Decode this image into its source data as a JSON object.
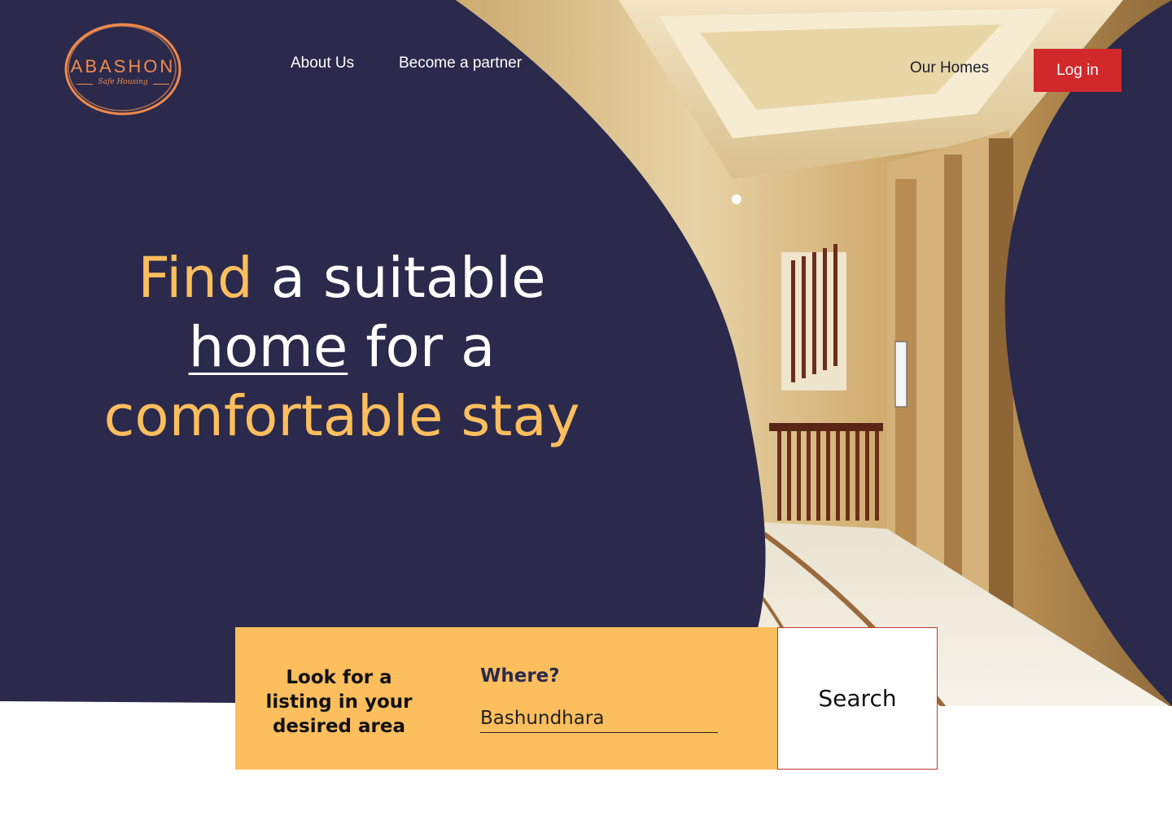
{
  "brand": {
    "name": "ABASHON",
    "tagline": "Safe Housing"
  },
  "nav": {
    "about": "About Us",
    "partner": "Become a partner",
    "homes": "Our Homes",
    "login": "Log in"
  },
  "hero": {
    "line1_accent": "Find",
    "line1_rest": " a suitable",
    "line2_underlined": "home",
    "line2_rest": " for a",
    "line3_accent": "comfortable stay"
  },
  "search": {
    "prompt": "Look for a listing in your desired area",
    "where_label": "Where?",
    "where_value": "Bashundhara",
    "button": "Search"
  },
  "colors": {
    "navy": "#2b2a4c",
    "accent": "#fdbe5e",
    "login_red": "#d1282b",
    "logo_orange": "#f08a4b"
  }
}
